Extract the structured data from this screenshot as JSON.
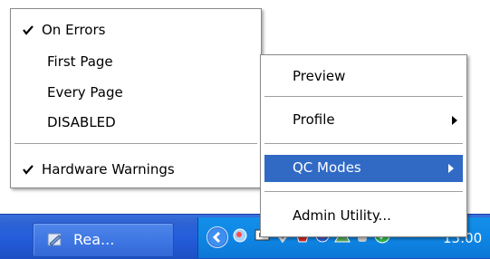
{
  "submenu": {
    "items": [
      {
        "label": "On Errors",
        "checked": true
      },
      {
        "label": "First Page",
        "checked": false
      },
      {
        "label": "Every Page",
        "checked": false
      },
      {
        "label": "DISABLED",
        "checked": false
      }
    ],
    "hardware_warnings": {
      "label": "Hardware Warnings",
      "checked": true
    }
  },
  "mainmenu": {
    "preview_label": "Preview",
    "profile_label": "Profile",
    "qc_modes_label": "QC Modes",
    "admin_utility_label": "Admin Utility..."
  },
  "taskbar": {
    "task_button_label": "Rea...",
    "clock": "15:00"
  },
  "colors": {
    "highlight": "#316ac5",
    "taskbar": "#245edb",
    "tray": "#0f86e4"
  }
}
